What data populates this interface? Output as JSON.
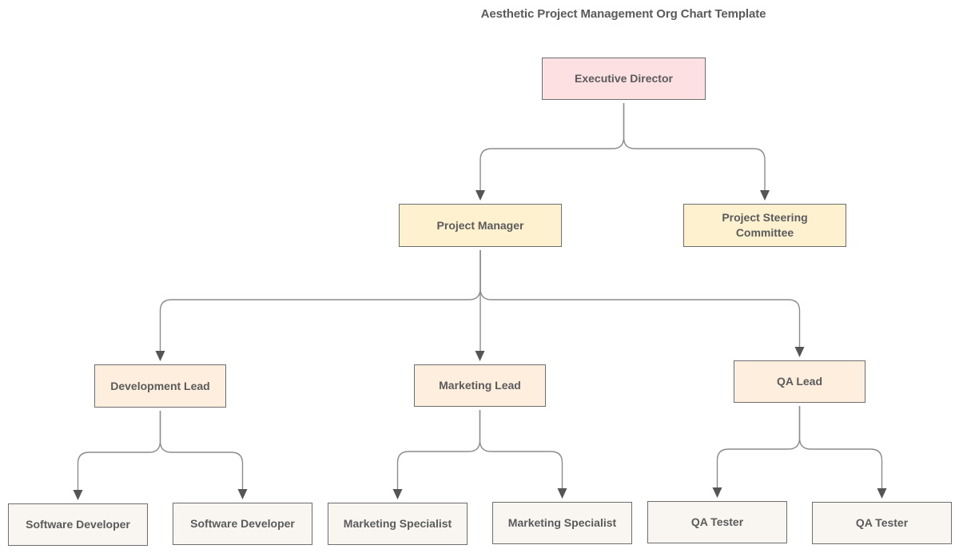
{
  "title": "Aesthetic Project Management Org Chart Template",
  "colors": {
    "executive": "#fde0e1",
    "management": "#fdf1cf",
    "leads": "#fdeede",
    "staff": "#f9f6f1",
    "border": "#6e6e6e",
    "connector": "#8c8c8c",
    "arrow": "#555555",
    "text": "#5b5b5b"
  },
  "nodes": [
    {
      "id": "executive-director",
      "label": "Executive Director",
      "level": 0,
      "parent": null
    },
    {
      "id": "project-manager",
      "label": "Project Manager",
      "level": 1,
      "parent": "executive-director"
    },
    {
      "id": "project-steering-committee",
      "label": "Project Steering Committee",
      "level": 1,
      "parent": "executive-director"
    },
    {
      "id": "development-lead",
      "label": "Development Lead",
      "level": 2,
      "parent": "project-manager"
    },
    {
      "id": "marketing-lead",
      "label": "Marketing Lead",
      "level": 2,
      "parent": "project-manager"
    },
    {
      "id": "qa-lead",
      "label": "QA Lead",
      "level": 2,
      "parent": "project-manager"
    },
    {
      "id": "software-developer-1",
      "label": "Software Developer",
      "level": 3,
      "parent": "development-lead"
    },
    {
      "id": "software-developer-2",
      "label": "Software Developer",
      "level": 3,
      "parent": "development-lead"
    },
    {
      "id": "marketing-specialist-1",
      "label": "Marketing Specialist",
      "level": 3,
      "parent": "marketing-lead"
    },
    {
      "id": "marketing-specialist-2",
      "label": "Marketing Specialist",
      "level": 3,
      "parent": "marketing-lead"
    },
    {
      "id": "qa-tester-1",
      "label": "QA Tester",
      "level": 3,
      "parent": "qa-lead"
    },
    {
      "id": "qa-tester-2",
      "label": "QA Tester",
      "level": 3,
      "parent": "qa-lead"
    }
  ]
}
